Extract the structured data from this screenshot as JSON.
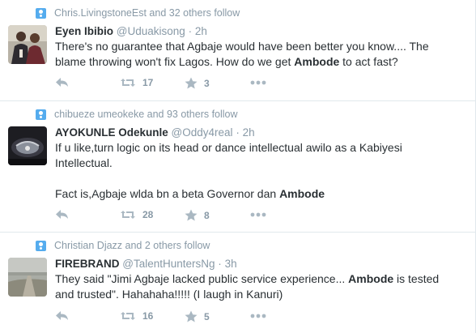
{
  "tweets": [
    {
      "context": "Chris.LivingstoneEst and 32 others follow",
      "name": "Eyen Ibibio",
      "handle": "@Uduakisong",
      "separator": "·",
      "time": "2h",
      "lines": [
        [
          {
            "t": "There's no guarantee that Agbaje would have been better you know.... The"
          }
        ],
        [
          {
            "t": "blame throwing won't fix Lagos. How do we get "
          },
          {
            "t": "Ambode",
            "b": true
          },
          {
            "t": " to act fast?"
          }
        ]
      ],
      "retweets": "17",
      "likes": "3"
    },
    {
      "context": "chibueze umeokeke and 93 others follow",
      "name": "AYOKUNLE Odekunle",
      "handle": "@Oddy4real",
      "separator": "·",
      "time": "2h",
      "lines": [
        [
          {
            "t": "If u like,turn logic on its head or dance intellectual awilo as a Kabiyesi"
          }
        ],
        [
          {
            "t": "Intellectual."
          }
        ],
        [
          {
            "t": ""
          }
        ],
        [
          {
            "t": "Fact is,Agbaje wlda bn a beta Governor dan "
          },
          {
            "t": "Ambode",
            "b": true
          }
        ]
      ],
      "retweets": "28",
      "likes": "8"
    },
    {
      "context": "Christian Djazz and 2 others follow",
      "name": "FIREBRAND",
      "handle": "@TalentHuntersNg",
      "separator": "·",
      "time": "3h",
      "lines": [
        [
          {
            "t": "They said \"Jimi Agbaje lacked public service experience... "
          },
          {
            "t": "Ambode",
            "b": true
          },
          {
            "t": " is tested"
          }
        ],
        [
          {
            "t": "and trusted\".  Hahahaha!!!!! (I laugh in Kanuri)"
          }
        ]
      ],
      "retweets": "16",
      "likes": "5"
    }
  ],
  "colors": {
    "accent": "#55acee",
    "muted": "#8899a6",
    "text": "#292f33",
    "border": "#e1e8ed"
  },
  "icons": {
    "reply": "reply-icon",
    "retweet": "retweet-icon",
    "like": "star-icon",
    "more": "more-icon",
    "context": "follow-context-icon"
  }
}
